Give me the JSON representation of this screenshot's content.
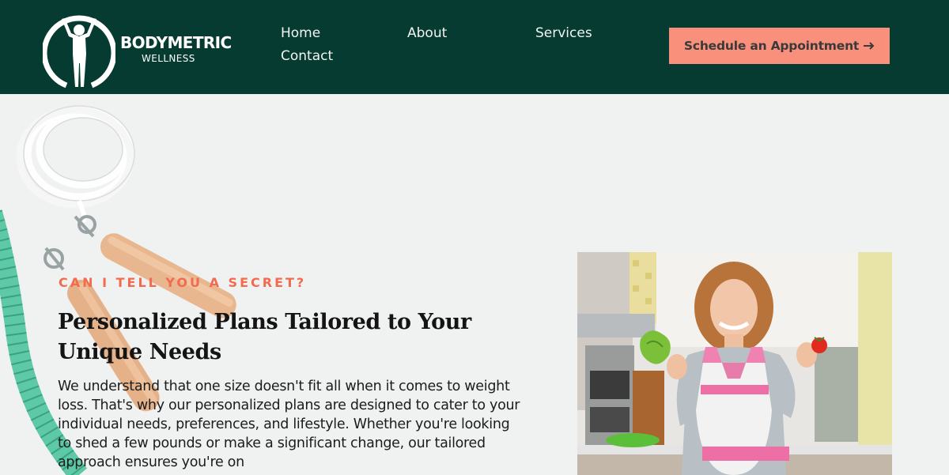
{
  "brand": {
    "name": "BODYMETRIC",
    "subtitle": "WELLNESS",
    "logo_icon": "figure-in-circle-icon"
  },
  "nav": {
    "items": [
      {
        "label": "Home"
      },
      {
        "label": "About"
      },
      {
        "label": "Services"
      },
      {
        "label": "Contact"
      }
    ]
  },
  "cta": {
    "label": "Schedule an Appointment",
    "icon": "arrow-right-icon",
    "background": "#f8907c"
  },
  "hero": {
    "eyebrow": "CAN I TELL YOU A SECRET?",
    "headline": "Personalized Plans Tailored to Your Unique Needs",
    "body": "We understand that one size doesn't fit all when it comes to weight loss. That's why our personalized plans are designed to cater to your individual needs, preferences, and lifestyle. Whether you're looking to shed a few pounds or make a significant change, our tailored approach ensures you're on"
  },
  "colors": {
    "header_bg": "#053b30",
    "accent": "#f36a4f",
    "page_bg": "#eff2f1"
  }
}
